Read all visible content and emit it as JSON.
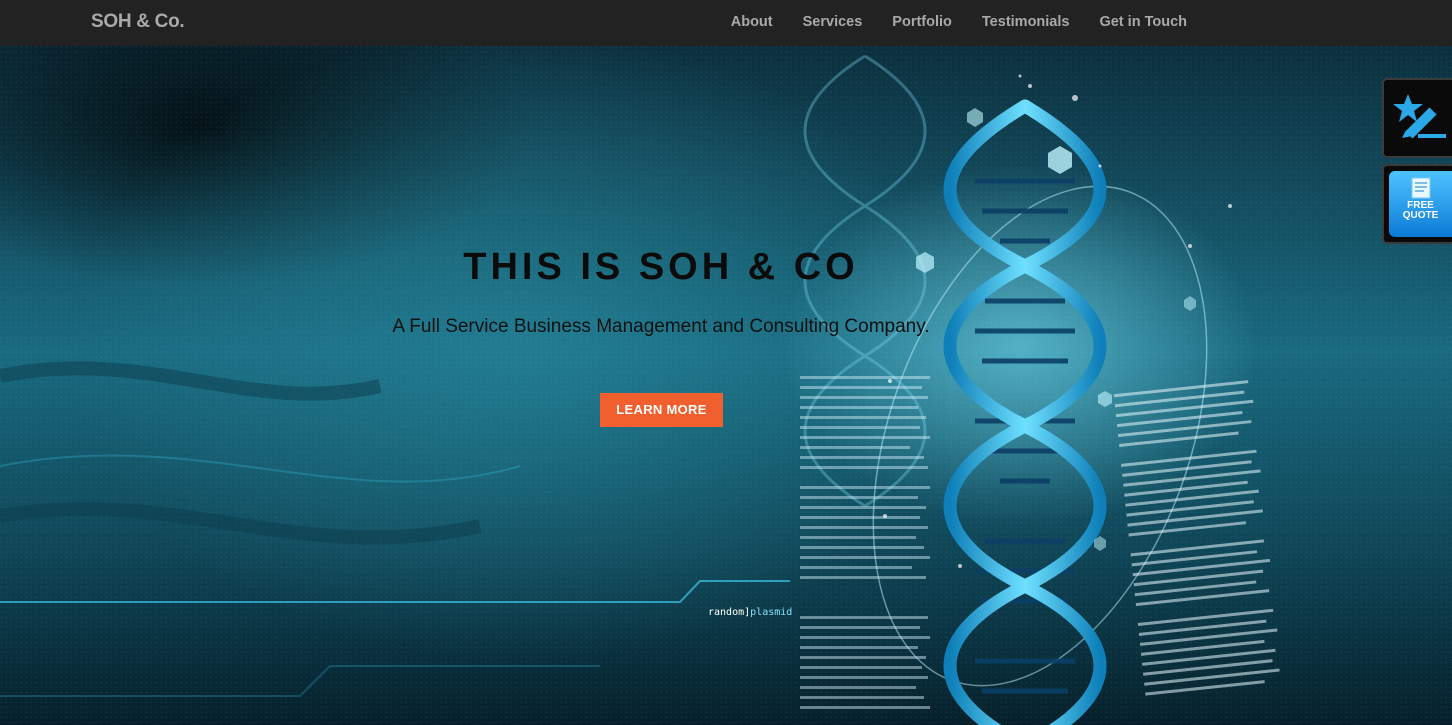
{
  "navbar": {
    "brand": "SOH & Co.",
    "links": [
      "About",
      "Services",
      "Portfolio",
      "Testimonials",
      "Get in Touch"
    ]
  },
  "hero": {
    "title": "THIS IS SOH & CO",
    "subtitle": "A Full Service Business Management and Consulting Company.",
    "cta_label": "LEARN MORE",
    "caption_left": "random]",
    "caption_right": "plasmid"
  },
  "sidebar": {
    "quote_line1": "FREE",
    "quote_line2": "QUOTE"
  },
  "colors": {
    "navbar_bg": "#222222",
    "nav_text": "#a9a9a9",
    "cta_bg": "#f05f2d",
    "accent_cyan": "#29b8ec"
  }
}
